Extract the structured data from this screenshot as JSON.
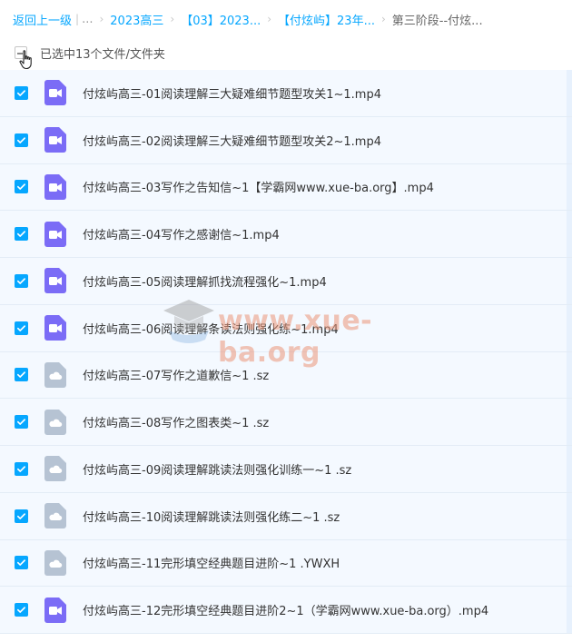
{
  "breadcrumb": {
    "back": "返回上一级",
    "separator_bar": "|",
    "ellipsis": "...",
    "chevron": "›",
    "items": [
      "2023高三",
      "【03】2023...",
      "【付炫屿】23年...",
      "第三阶段--付炫..."
    ]
  },
  "selection": {
    "label": "已选中13个文件/文件夹"
  },
  "colors": {
    "accent": "#06a7ff",
    "video_icon": "#7b6cf6",
    "archive_icon": "#b6c3d3"
  },
  "files": [
    {
      "name": "付炫屿高三-01阅读理解三大疑难细节题型攻关1~1.mp4",
      "icon": "video-icon",
      "checked": true
    },
    {
      "name": "付炫屿高三-02阅读理解三大疑难细节题型攻关2~1.mp4",
      "icon": "video-icon",
      "checked": true
    },
    {
      "name": "付炫屿高三-03写作之告知信~1【学霸网www.xue-ba.org】.mp4",
      "icon": "video-icon",
      "checked": true
    },
    {
      "name": "付炫屿高三-04写作之感谢信~1.mp4",
      "icon": "video-icon",
      "checked": true
    },
    {
      "name": "付炫屿高三-05阅读理解抓找流程强化~1.mp4",
      "icon": "video-icon",
      "checked": true
    },
    {
      "name": "付炫屿高三-06阅读理解条读法则强化练~1.mp4",
      "icon": "video-icon",
      "checked": true
    },
    {
      "name": "付炫屿高三-07写作之道歉信~1 .sz",
      "icon": "cloud-file-icon",
      "checked": true
    },
    {
      "name": "付炫屿高三-08写作之图表类~1 .sz",
      "icon": "cloud-file-icon",
      "checked": true
    },
    {
      "name": "付炫屿高三-09阅读理解跳读法则强化训练一~1 .sz",
      "icon": "cloud-file-icon",
      "checked": true
    },
    {
      "name": "付炫屿高三-10阅读理解跳读法则强化练二~1 .sz",
      "icon": "cloud-file-icon",
      "checked": true
    },
    {
      "name": "付炫屿高三-11完形填空经典题目进阶~1 .YWXH",
      "icon": "cloud-file-icon",
      "checked": true
    },
    {
      "name": "付炫屿高三-12完形填空经典题目进阶2~1（学霸网www.xue-ba.org）.mp4",
      "icon": "video-icon",
      "checked": true
    }
  ],
  "watermark": {
    "text": "www.xue-ba.org"
  }
}
